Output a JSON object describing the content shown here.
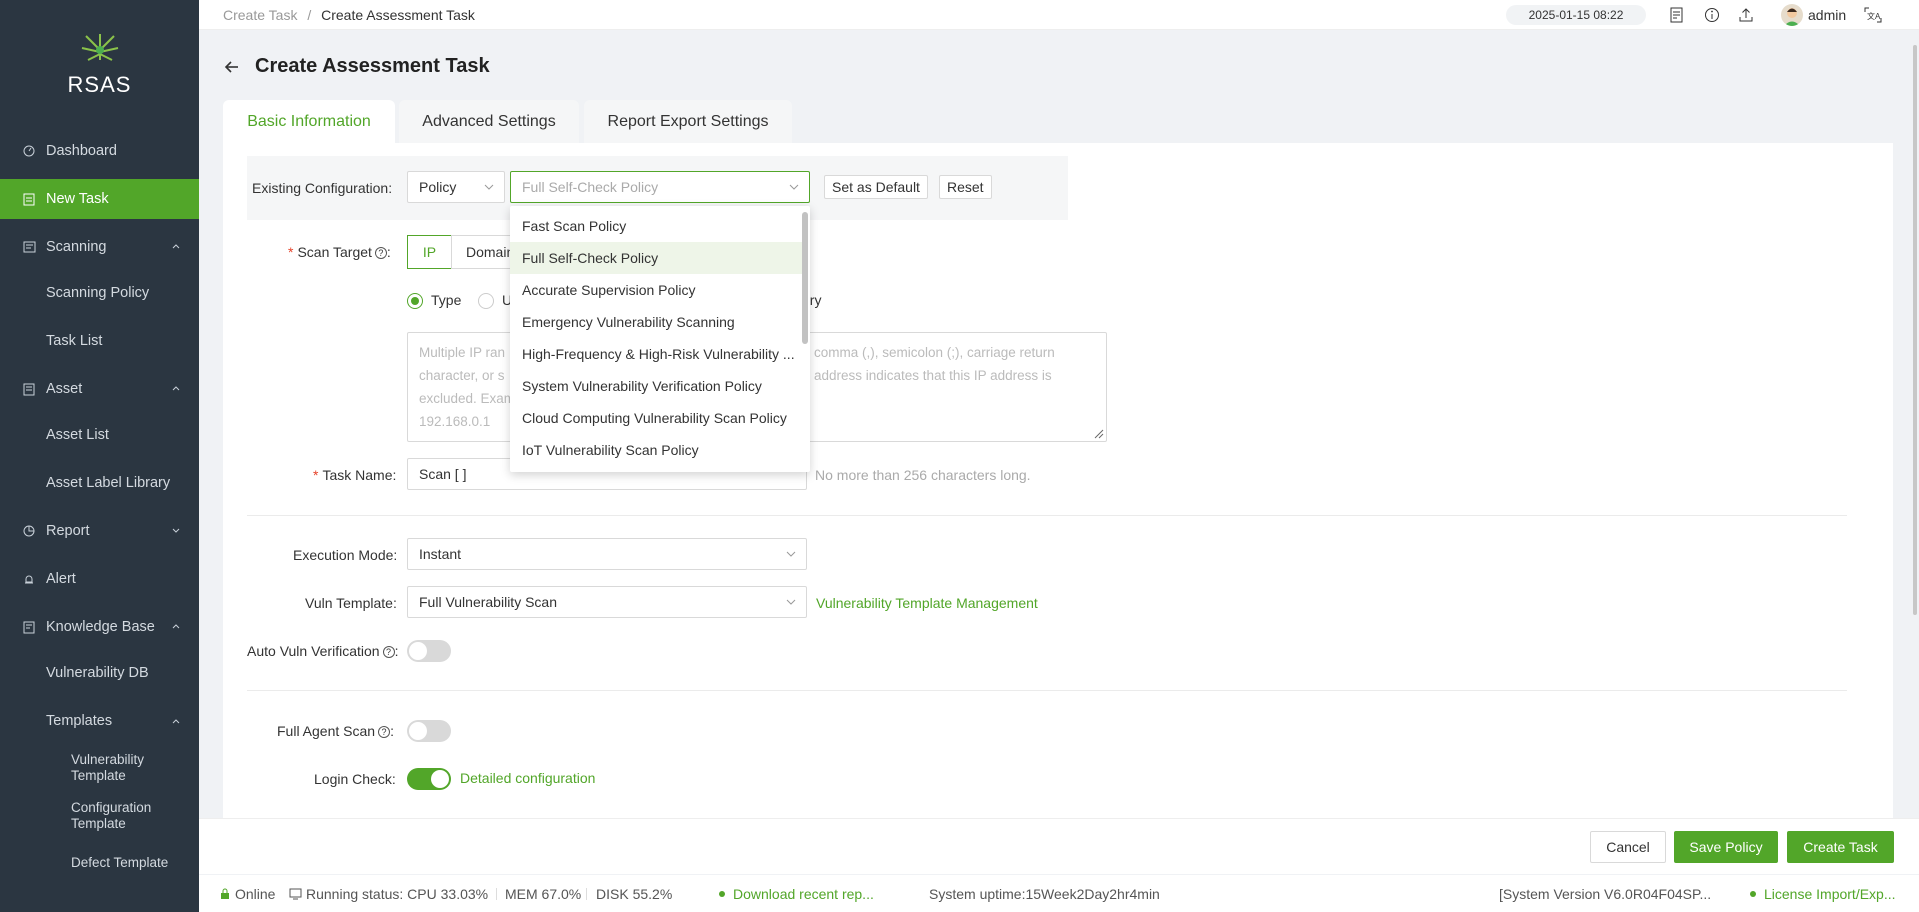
{
  "app": {
    "name": "RSAS"
  },
  "sidebar": {
    "items": [
      {
        "label": "Dashboard"
      },
      {
        "label": "New Task"
      },
      {
        "label": "Scanning"
      },
      {
        "label": "Scanning Policy"
      },
      {
        "label": "Task List"
      },
      {
        "label": "Asset"
      },
      {
        "label": "Asset List"
      },
      {
        "label": "Asset Label Library"
      },
      {
        "label": "Report"
      },
      {
        "label": "Alert"
      },
      {
        "label": "Knowledge Base"
      },
      {
        "label": "Vulnerability DB"
      },
      {
        "label": "Templates"
      },
      {
        "label": "Vulnerability Template"
      },
      {
        "label": "Configuration Template"
      },
      {
        "label": "Defect Template"
      }
    ]
  },
  "topbar": {
    "breadcrumb": [
      "Create Task",
      "/",
      "Create Assessment Task"
    ],
    "datetime": "2025-01-15 08:22",
    "user": "admin"
  },
  "page": {
    "title": "Create Assessment Task"
  },
  "tabs": [
    {
      "label": "Basic Information",
      "active": true
    },
    {
      "label": "Advanced Settings",
      "active": false
    },
    {
      "label": "Report Export Settings",
      "active": false
    }
  ],
  "form": {
    "existing_config": {
      "label": "Existing Configuration",
      "type_value": "Policy",
      "policy_value": "Full Self-Check Policy",
      "set_default": "Set as Default",
      "reset": "Reset"
    },
    "scan_target": {
      "label": "Scan Target",
      "seg_ip": "IP",
      "seg_domain": "Domain",
      "radio_type": "Type",
      "radio_u": "U",
      "radio_tail": "ory",
      "textarea_left": [
        "Multiple IP ran",
        "character, or s",
        "excluded. Exam",
        "192.168.0.1"
      ],
      "textarea_right": [
        "comma (,), semicolon (;), carriage return",
        "address indicates that this IP address is"
      ]
    },
    "task_name": {
      "label": "Task Name",
      "value": "Scan [ ]",
      "hint": "No more than 256 characters long."
    },
    "execution_mode": {
      "label": "Execution Mode",
      "value": "Instant"
    },
    "vuln_template": {
      "label": "Vuln Template",
      "value": "Full Vulnerability Scan",
      "link": "Vulnerability Template Management"
    },
    "auto_vuln_verification": {
      "label": "Auto Vuln Verification",
      "on": false
    },
    "full_agent_scan": {
      "label": "Full Agent Scan",
      "on": false
    },
    "login_check": {
      "label": "Login Check",
      "on": true,
      "link": "Detailed configuration"
    }
  },
  "dropdown": {
    "options": [
      "Fast Scan Policy",
      "Full Self-Check Policy",
      "Accurate Supervision Policy",
      "Emergency Vulnerability Scanning",
      "High-Frequency & High-Risk Vulnerability ...",
      "System Vulnerability Verification Policy",
      "Cloud Computing Vulnerability Scan Policy",
      "IoT Vulnerability Scan Policy"
    ],
    "selected_index": 1
  },
  "actions": {
    "cancel": "Cancel",
    "save_policy": "Save Policy",
    "create_task": "Create Task"
  },
  "statusbar": {
    "online": "Online",
    "running_status": "Running status: CPU 33.03%",
    "mem": "MEM 67.0%",
    "disk": "DISK 55.2%",
    "download": "Download recent rep...",
    "uptime": "System uptime:15Week2Day2hr4min",
    "version": "[System Version V6.0R04F04SP...",
    "license": "License Import/Exp..."
  },
  "colors": {
    "accent": "#52a629",
    "sidebar_bg": "#2b3641"
  }
}
